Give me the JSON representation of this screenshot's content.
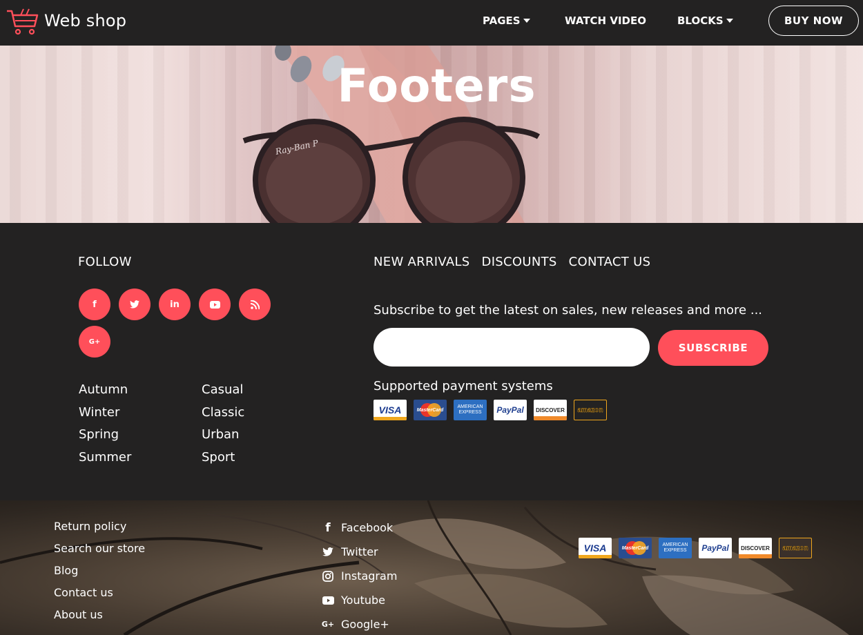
{
  "nav": {
    "brand": "Web shop",
    "items": [
      {
        "label": "PAGES",
        "dropdown": true
      },
      {
        "label": "WATCH VIDEO",
        "dropdown": false
      },
      {
        "label": "BLOCKS",
        "dropdown": true
      }
    ],
    "cta": "BUY NOW"
  },
  "hero": {
    "title": "Footers"
  },
  "footer": {
    "follow_title": "FOLLOW",
    "social_icons": [
      "facebook-icon",
      "twitter-icon",
      "linkedin-icon",
      "youtube-icon",
      "rss-icon",
      "google-plus-icon"
    ],
    "social_glyphs": [
      "f",
      "t",
      "in",
      "▶",
      "))",
      "G+"
    ],
    "column1": [
      "Autumn",
      "Winter",
      "Spring",
      "Summer"
    ],
    "column2": [
      "Casual",
      "Classic",
      "Urban",
      "Sport"
    ],
    "top_links": [
      "NEW ARRIVALS",
      "DISCOUNTS",
      "CONTACT US"
    ],
    "subscribe_text": "Subscribe to get the latest on sales, new releases and more ...",
    "email_placeholder": "",
    "subscribe_button": "SUBSCRIBE",
    "payment_title": "Supported payment systems",
    "payments": [
      "VISA",
      "MasterCard",
      "AMERICAN EXPRESS",
      "PayPal",
      "DISCOVER",
      "amazon"
    ]
  },
  "bottom": {
    "links": [
      "Return policy",
      "Search our store",
      "Blog",
      "Contact us",
      "About us"
    ],
    "social": [
      {
        "label": "Facebook",
        "icon": "facebook-icon"
      },
      {
        "label": "Twitter",
        "icon": "twitter-icon"
      },
      {
        "label": "Instagram",
        "icon": "instagram-icon"
      },
      {
        "label": "Youtube",
        "icon": "youtube-icon"
      },
      {
        "label": "Google+",
        "icon": "google-plus-icon"
      }
    ]
  },
  "colors": {
    "accent": "#ff4f5a",
    "dark": "#232222",
    "text": "#ffffff"
  }
}
